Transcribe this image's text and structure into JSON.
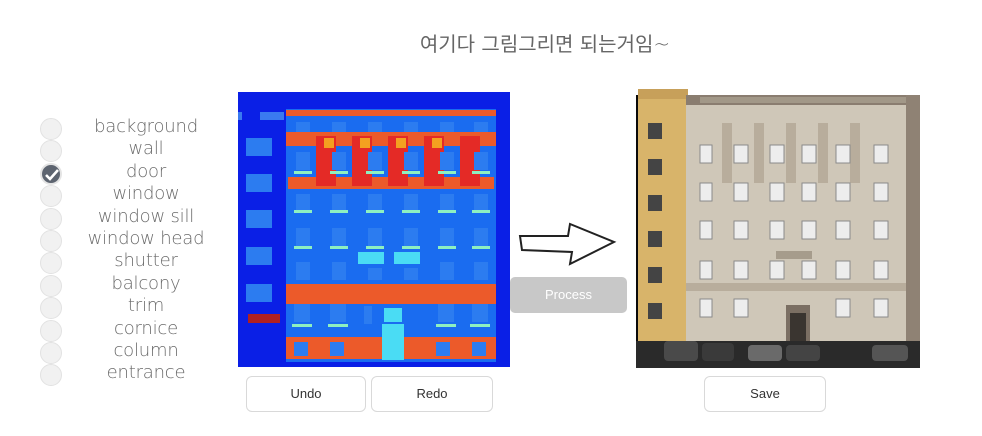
{
  "title": "여기다 그림그리면 되는거임~",
  "labels": [
    {
      "text": "background",
      "checked": false
    },
    {
      "text": "wall",
      "checked": false
    },
    {
      "text": "door",
      "checked": true
    },
    {
      "text": "window",
      "checked": false
    },
    {
      "text": "window sill",
      "checked": false
    },
    {
      "text": "window head",
      "checked": false
    },
    {
      "text": "shutter",
      "checked": false
    },
    {
      "text": "balcony",
      "checked": false
    },
    {
      "text": "trim",
      "checked": false
    },
    {
      "text": "cornice",
      "checked": false
    },
    {
      "text": "column",
      "checked": false
    },
    {
      "text": "entrance",
      "checked": false
    }
  ],
  "buttons": {
    "undo": "Undo",
    "redo": "Redo",
    "process": "Process",
    "save": "Save"
  },
  "colors": {
    "background_label": "#0a1fe6",
    "wall_label": "#1a6cf0",
    "trim_label": "#ec5a2a",
    "column_label": "#e42a26",
    "window_label": "#2c7cf0",
    "sill_label": "#8ef0c0",
    "entrance_label": "#4adcf4"
  }
}
